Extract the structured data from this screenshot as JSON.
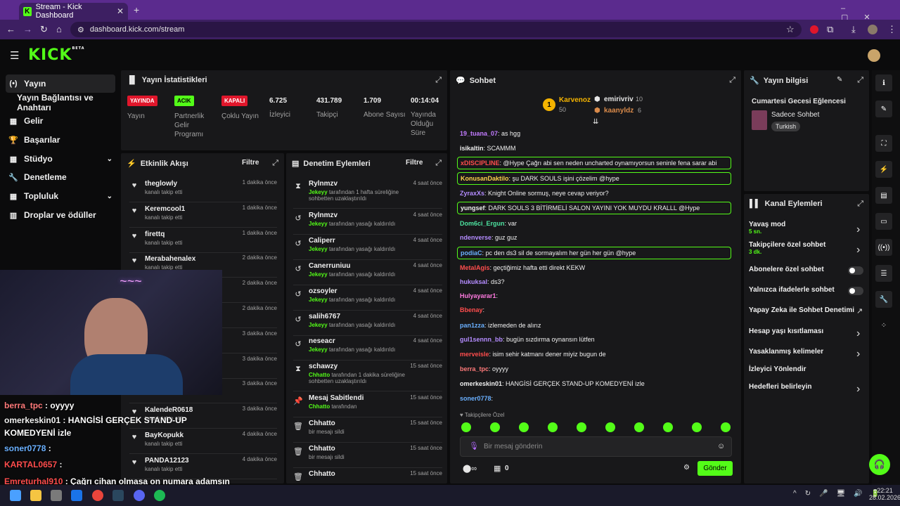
{
  "browser": {
    "tab_title": "Stream - Kick Dashboard",
    "url": "dashboard.kick.com/stream"
  },
  "nav": {
    "items": [
      {
        "label": "Yayın",
        "icon": "broadcast-icon"
      },
      {
        "label": "Yayın Bağlantısı ve Anahtarı",
        "icon": "link-icon"
      },
      {
        "label": "Gelir",
        "icon": "money-icon"
      },
      {
        "label": "Başarılar",
        "icon": "trophy-icon"
      },
      {
        "label": "Stüdyo",
        "icon": "studio-icon"
      },
      {
        "label": "Denetleme",
        "icon": "wrench-icon"
      },
      {
        "label": "Topluluk",
        "icon": "users-icon"
      },
      {
        "label": "Droplar ve ödüller",
        "icon": "gift-icon"
      }
    ]
  },
  "stats": {
    "title": "Yayın İstatistikleri",
    "live_badge": "YAYINDA",
    "live_label": "Yayın",
    "partner_badge": "ACIK",
    "partner_label": "Partnerlik Gelir Programı",
    "multi_badge": "KAPALI",
    "multi_label": "Çoklu Yayın",
    "viewers": "6.725",
    "viewers_label": "İzleyici",
    "followers": "431.789",
    "followers_label": "Takipçi",
    "subs": "1.709",
    "subs_label": "Abone Sayısı",
    "uptime": "00:14:04",
    "uptime_label": "Yayında Olduğu Süre"
  },
  "activity": {
    "title": "Etkinlik Akışı",
    "filter": "Filtre",
    "rows": [
      {
        "user": "theglowly",
        "action": "kanalı takip etti",
        "time": "1 dakika önce"
      },
      {
        "user": "Keremcool1",
        "action": "kanalı takip etti",
        "time": "1 dakika önce"
      },
      {
        "user": "firettq",
        "action": "kanalı takip etti",
        "time": "1 dakika önce"
      },
      {
        "user": "Merabahenalex",
        "action": "kanalı takip etti",
        "time": "2 dakika önce"
      },
      {
        "user": "",
        "action": "",
        "time": "2 dakika önce"
      },
      {
        "user": "",
        "action": "",
        "time": "2 dakika önce"
      },
      {
        "user": "",
        "action": "",
        "time": "3 dakika önce"
      },
      {
        "user": "",
        "action": "",
        "time": "3 dakika önce"
      },
      {
        "user": "",
        "action": "",
        "time": "3 dakika önce"
      },
      {
        "user": "KalendeR0618",
        "action": "kanalı takip etti",
        "time": "3 dakika önce"
      },
      {
        "user": "BayKopukk",
        "action": "kanalı takip etti",
        "time": "4 dakika önce"
      },
      {
        "user": "PANDA12123",
        "action": "kanalı takip etti",
        "time": "4 dakika önce"
      }
    ]
  },
  "moderation": {
    "title": "Denetim Eylemleri",
    "filter": "Filtre",
    "rows": [
      {
        "user": "Rylnmzv",
        "by": "Jekeyy",
        "action": "tarafından 1 hafta süreliğine sohbetten uzaklaştırıldı",
        "time": "4 saat önce",
        "icon": "hourglass-icon"
      },
      {
        "user": "Rylnmzv",
        "by": "Jekeyy",
        "action": "tarafından yasağı kaldırıldı",
        "time": "4 saat önce",
        "icon": "undo-icon"
      },
      {
        "user": "Caliperr",
        "by": "Jekeyy",
        "action": "tarafından yasağı kaldırıldı",
        "time": "4 saat önce",
        "icon": "undo-icon"
      },
      {
        "user": "Canerruniuu",
        "by": "Jekeyy",
        "action": "tarafından yasağı kaldırıldı",
        "time": "4 saat önce",
        "icon": "undo-icon"
      },
      {
        "user": "ozsoyler",
        "by": "Jekeyy",
        "action": "tarafından yasağı kaldırıldı",
        "time": "4 saat önce",
        "icon": "undo-icon"
      },
      {
        "user": "salih6767",
        "by": "Jekeyy",
        "action": "tarafından yasağı kaldırıldı",
        "time": "4 saat önce",
        "icon": "undo-icon"
      },
      {
        "user": "neseacr",
        "by": "Jekeyy",
        "action": "tarafından yasağı kaldırıldı",
        "time": "4 saat önce",
        "icon": "undo-icon"
      },
      {
        "user": "schawzy",
        "by": "Chhatto",
        "action": "tarafından 1 dakika süreliğine sohbetten uzaklaştırıldı",
        "time": "15 saat önce",
        "icon": "hourglass-icon"
      },
      {
        "user": "Mesaj Sabitlendi",
        "by": "Chhatto",
        "action": "tarafından",
        "time": "15 saat önce",
        "icon": "pin-icon"
      },
      {
        "user": "Chhatto",
        "by": "",
        "action": "bir mesajı sildi",
        "time": "15 saat önce",
        "icon": "trash-icon"
      },
      {
        "user": "Chhatto",
        "by": "",
        "action": "bir mesajı sildi",
        "time": "15 saat önce",
        "icon": "trash-icon"
      },
      {
        "user": "Chhatto",
        "by": "",
        "action": "",
        "time": "15 saat önce",
        "icon": "trash-icon"
      }
    ]
  },
  "chat": {
    "title": "Sohbet",
    "leaders": [
      {
        "rank": "1",
        "name": "Karvenoz",
        "count": "50"
      },
      {
        "rank": "",
        "name": "emirivriv",
        "count": "10"
      },
      {
        "rank": "",
        "name": "kaanyldz",
        "count": "6"
      }
    ],
    "messages": [
      {
        "user": "19_tuana_07",
        "text": ": as hgg",
        "color": "#c27bff",
        "boxed": false
      },
      {
        "user": "isikaltin",
        "text": ": SCAMMM",
        "color": "#f0f0f0",
        "boxed": false
      },
      {
        "user": "xDISCIPLINE",
        "text": ": @Hype Çağrı abi sen neden uncharted oynamıyorsun seninle fena sarar abi",
        "color": "#ff4d4d",
        "boxed": true
      },
      {
        "user": "KonusanDaktilo",
        "text": ": şu DARK SOULS işini çözelim @hype",
        "color": "#ffd24d",
        "boxed": true
      },
      {
        "user": "ZyraxXs",
        "text": ": Knight Online sormuş, neye cevap veriyor?",
        "color": "#b48cff",
        "boxed": false
      },
      {
        "user": "yungsef",
        "text": ": DARK SOULS 3 BİTİRMELİ SALON YAYINI YOK MUYDU KRALLL @Hype",
        "color": "#f0f0f0",
        "boxed": true
      },
      {
        "user": "Dom6ci_Ergun",
        "text": ": var",
        "color": "#4de3a0",
        "boxed": false
      },
      {
        "user": "ndenverse",
        "text": ": guz guz",
        "color": "#b48cff",
        "boxed": false
      },
      {
        "user": "podiaC",
        "text": ": pc den ds3 sil de sormayalım her gün her gün @hype",
        "color": "#6ab0ff",
        "boxed": true
      },
      {
        "user": "MetalAgis",
        "text": ": geçtiğimiz hafta etti direkt KEKW",
        "color": "#ff4d4d",
        "boxed": false
      },
      {
        "user": "hukuksal",
        "text": ": ds3?",
        "color": "#b48cff",
        "boxed": false
      },
      {
        "user": "Hulyayarar1",
        "text": ":",
        "color": "#ff7ae0",
        "boxed": false
      },
      {
        "user": "Bbenay",
        "text": ":",
        "color": "#ff4d4d",
        "boxed": false
      },
      {
        "user": "pan1zza",
        "text": ": izlemeden de alırız",
        "color": "#6ab0ff",
        "boxed": false
      },
      {
        "user": "gul1sennn_bb",
        "text": ": bugün sızdırma oynansın lütfen",
        "color": "#b48cff",
        "boxed": false
      },
      {
        "user": "merveisle",
        "text": ": isim sehir katmanı dener miyiz bugun de",
        "color": "#ff4d4d",
        "boxed": false
      },
      {
        "user": "berra_tpc",
        "text": ": oyyyy",
        "color": "#ff7a7a",
        "boxed": false
      },
      {
        "user": "omerkeskin01",
        "text": ": HANGİSİ GERÇEK STAND-UP KOMEDYENİ izle",
        "color": "#f0f0f0",
        "boxed": false
      },
      {
        "user": "soner0778",
        "text": ":",
        "color": "#6ab0ff",
        "boxed": false
      }
    ],
    "followers_only": "Takipçilere Özel",
    "input_placeholder": "Bir mesaj gönderin",
    "points": "0",
    "send": "Gönder"
  },
  "stream_info": {
    "title": "Yayın bilgisi",
    "stream_title": "Cumartesi Gecesi Eğlencesi",
    "category": "Sadece Sohbet",
    "language": "Turkish"
  },
  "channel_actions": {
    "title": "Kanal Eylemleri",
    "items": [
      {
        "label": "Yavaş mod",
        "sub": "5 sn."
      },
      {
        "label": "Takipçilere özel sohbet",
        "sub": "3 dk."
      },
      {
        "label": "Abonelere özel sohbet",
        "sub": ""
      },
      {
        "label": "Yalnızca ifadelerle sohbet",
        "sub": ""
      },
      {
        "label": "Yapay Zeka ile Sohbet Denetimi",
        "sub": ""
      },
      {
        "label": "Hesap yaşı kısıtlaması",
        "sub": ""
      },
      {
        "label": "Yasaklanmış kelimeler",
        "sub": ""
      },
      {
        "label": "İzleyici Yönlendir",
        "sub": ""
      },
      {
        "label": "Hedefleri belirleyin",
        "sub": ""
      }
    ]
  },
  "overlay_chat": [
    {
      "user": "berra_tpc",
      "text": " : oyyyy",
      "color": "#ff7a7a"
    },
    {
      "user": "omerkeskin01",
      "text": " : HANGİSİ GERÇEK STAND-UP",
      "color": "#f0f0f0"
    },
    {
      "user": "",
      "text": "KOMEDYENİ izle",
      "color": "#f0f0f0"
    },
    {
      "user": "soner0778",
      "text": " :",
      "color": "#6ab0ff"
    },
    {
      "user": "KARTAL0657",
      "text": " :",
      "color": "#ff4d4d"
    },
    {
      "user": "Emreturhal910",
      "text": " : Çağrı cihan olmasa on numara adamsın",
      "color": "#ff4d4d"
    }
  ],
  "taskbar": {
    "time": "22:21",
    "date": "28.02.2026"
  },
  "colors": {
    "accent": "#53fc18",
    "live": "#e0162b",
    "panel": "#18181a"
  }
}
